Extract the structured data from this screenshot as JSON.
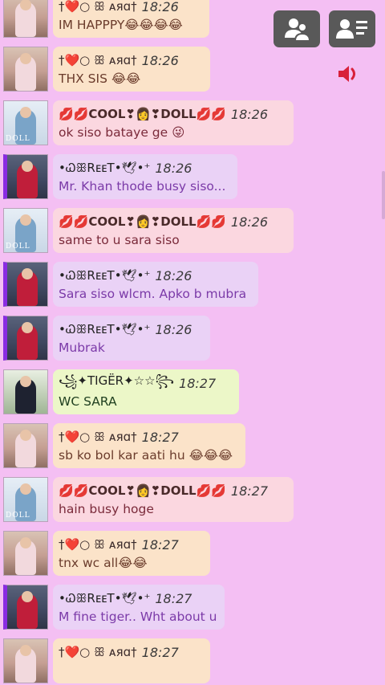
{
  "toolbar": {
    "users_button": "users-icon",
    "profile_button": "profile-menu-icon",
    "sound": "speaker-icon"
  },
  "colors": {
    "background": "#f4bff3",
    "princess_bubble": "#fbe3c9",
    "doll_bubble": "#fbd7e0",
    "preet_bubble": "#ead2f6",
    "tiger_bubble": "#ecf7c8",
    "icon_red": "#d8203a"
  },
  "messages": [
    {
      "user": "†❤️○ ꕥ ᴀяɑ†",
      "time": "18:26",
      "text": "IM HAPPPY😂😂😂😂",
      "style": "princess"
    },
    {
      "user": "†❤️○ ꕥ ᴀяɑ†",
      "time": "18:26",
      "text": "THX SIS 😂😂",
      "style": "princess"
    },
    {
      "user": "💋💋COOL❣👩❣DOLL💋💋",
      "time": "18:26",
      "text": "ok siso bataye ge 😜",
      "style": "doll"
    },
    {
      "user": "•ᏇꕥRᴇᴇT•🕊•⁺",
      "time": "18:26",
      "text": "Mr. Khan thode busy siso...",
      "style": "preet"
    },
    {
      "user": "💋💋COOL❣👩❣DOLL💋💋",
      "time": "18:26",
      "text": "same to u sara siso",
      "style": "doll"
    },
    {
      "user": "•ᏇꕥRᴇᴇT•🕊•⁺",
      "time": "18:26",
      "text": "Sara siso wlcm. Apko b mubra",
      "style": "preet"
    },
    {
      "user": "•ᏇꕥRᴇᴇT•🕊•⁺",
      "time": "18:26",
      "text": "Mubrak",
      "style": "preet"
    },
    {
      "user": "꧁✦TIGЁR✦☆☆꧂",
      "time": "18:27",
      "text": "WC SARA",
      "style": "tiger"
    },
    {
      "user": "†❤️○ ꕥ ᴀяɑ†",
      "time": "18:27",
      "text": "sb ko bol kar aati hu 😂😂😂",
      "style": "princess"
    },
    {
      "user": "💋💋COOL❣👩❣DOLL💋💋",
      "time": "18:27",
      "text": "hain busy hoge",
      "style": "doll"
    },
    {
      "user": "†❤️○ ꕥ ᴀяɑ†",
      "time": "18:27",
      "text": "tnx wc all😂😂",
      "style": "princess"
    },
    {
      "user": "•ᏇꕥRᴇᴇT•🕊•⁺",
      "time": "18:27",
      "text": "M fine tiger.. Wht about u",
      "style": "preet"
    },
    {
      "user": "†❤️○ ꕥ ᴀяɑ†",
      "time": "18:27",
      "text": "",
      "style": "princess"
    }
  ],
  "avatar_tags": {
    "doll": "DOLL"
  }
}
